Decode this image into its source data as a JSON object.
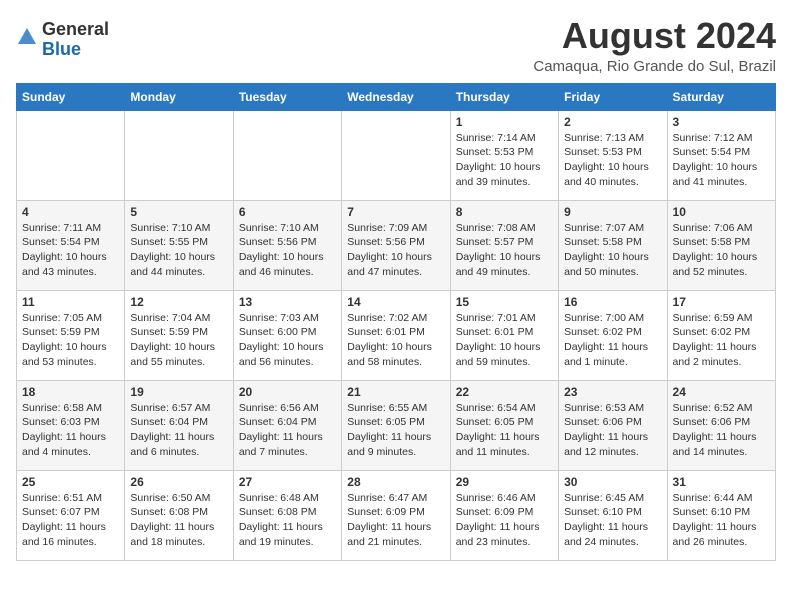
{
  "header": {
    "logo_general": "General",
    "logo_blue": "Blue",
    "month_title": "August 2024",
    "location": "Camaqua, Rio Grande do Sul, Brazil"
  },
  "days_of_week": [
    "Sunday",
    "Monday",
    "Tuesday",
    "Wednesday",
    "Thursday",
    "Friday",
    "Saturday"
  ],
  "weeks": [
    [
      {
        "day": "",
        "content": ""
      },
      {
        "day": "",
        "content": ""
      },
      {
        "day": "",
        "content": ""
      },
      {
        "day": "",
        "content": ""
      },
      {
        "day": "1",
        "content": "Sunrise: 7:14 AM\nSunset: 5:53 PM\nDaylight: 10 hours\nand 39 minutes."
      },
      {
        "day": "2",
        "content": "Sunrise: 7:13 AM\nSunset: 5:53 PM\nDaylight: 10 hours\nand 40 minutes."
      },
      {
        "day": "3",
        "content": "Sunrise: 7:12 AM\nSunset: 5:54 PM\nDaylight: 10 hours\nand 41 minutes."
      }
    ],
    [
      {
        "day": "4",
        "content": "Sunrise: 7:11 AM\nSunset: 5:54 PM\nDaylight: 10 hours\nand 43 minutes."
      },
      {
        "day": "5",
        "content": "Sunrise: 7:10 AM\nSunset: 5:55 PM\nDaylight: 10 hours\nand 44 minutes."
      },
      {
        "day": "6",
        "content": "Sunrise: 7:10 AM\nSunset: 5:56 PM\nDaylight: 10 hours\nand 46 minutes."
      },
      {
        "day": "7",
        "content": "Sunrise: 7:09 AM\nSunset: 5:56 PM\nDaylight: 10 hours\nand 47 minutes."
      },
      {
        "day": "8",
        "content": "Sunrise: 7:08 AM\nSunset: 5:57 PM\nDaylight: 10 hours\nand 49 minutes."
      },
      {
        "day": "9",
        "content": "Sunrise: 7:07 AM\nSunset: 5:58 PM\nDaylight: 10 hours\nand 50 minutes."
      },
      {
        "day": "10",
        "content": "Sunrise: 7:06 AM\nSunset: 5:58 PM\nDaylight: 10 hours\nand 52 minutes."
      }
    ],
    [
      {
        "day": "11",
        "content": "Sunrise: 7:05 AM\nSunset: 5:59 PM\nDaylight: 10 hours\nand 53 minutes."
      },
      {
        "day": "12",
        "content": "Sunrise: 7:04 AM\nSunset: 5:59 PM\nDaylight: 10 hours\nand 55 minutes."
      },
      {
        "day": "13",
        "content": "Sunrise: 7:03 AM\nSunset: 6:00 PM\nDaylight: 10 hours\nand 56 minutes."
      },
      {
        "day": "14",
        "content": "Sunrise: 7:02 AM\nSunset: 6:01 PM\nDaylight: 10 hours\nand 58 minutes."
      },
      {
        "day": "15",
        "content": "Sunrise: 7:01 AM\nSunset: 6:01 PM\nDaylight: 10 hours\nand 59 minutes."
      },
      {
        "day": "16",
        "content": "Sunrise: 7:00 AM\nSunset: 6:02 PM\nDaylight: 11 hours\nand 1 minute."
      },
      {
        "day": "17",
        "content": "Sunrise: 6:59 AM\nSunset: 6:02 PM\nDaylight: 11 hours\nand 2 minutes."
      }
    ],
    [
      {
        "day": "18",
        "content": "Sunrise: 6:58 AM\nSunset: 6:03 PM\nDaylight: 11 hours\nand 4 minutes."
      },
      {
        "day": "19",
        "content": "Sunrise: 6:57 AM\nSunset: 6:04 PM\nDaylight: 11 hours\nand 6 minutes."
      },
      {
        "day": "20",
        "content": "Sunrise: 6:56 AM\nSunset: 6:04 PM\nDaylight: 11 hours\nand 7 minutes."
      },
      {
        "day": "21",
        "content": "Sunrise: 6:55 AM\nSunset: 6:05 PM\nDaylight: 11 hours\nand 9 minutes."
      },
      {
        "day": "22",
        "content": "Sunrise: 6:54 AM\nSunset: 6:05 PM\nDaylight: 11 hours\nand 11 minutes."
      },
      {
        "day": "23",
        "content": "Sunrise: 6:53 AM\nSunset: 6:06 PM\nDaylight: 11 hours\nand 12 minutes."
      },
      {
        "day": "24",
        "content": "Sunrise: 6:52 AM\nSunset: 6:06 PM\nDaylight: 11 hours\nand 14 minutes."
      }
    ],
    [
      {
        "day": "25",
        "content": "Sunrise: 6:51 AM\nSunset: 6:07 PM\nDaylight: 11 hours\nand 16 minutes."
      },
      {
        "day": "26",
        "content": "Sunrise: 6:50 AM\nSunset: 6:08 PM\nDaylight: 11 hours\nand 18 minutes."
      },
      {
        "day": "27",
        "content": "Sunrise: 6:48 AM\nSunset: 6:08 PM\nDaylight: 11 hours\nand 19 minutes."
      },
      {
        "day": "28",
        "content": "Sunrise: 6:47 AM\nSunset: 6:09 PM\nDaylight: 11 hours\nand 21 minutes."
      },
      {
        "day": "29",
        "content": "Sunrise: 6:46 AM\nSunset: 6:09 PM\nDaylight: 11 hours\nand 23 minutes."
      },
      {
        "day": "30",
        "content": "Sunrise: 6:45 AM\nSunset: 6:10 PM\nDaylight: 11 hours\nand 24 minutes."
      },
      {
        "day": "31",
        "content": "Sunrise: 6:44 AM\nSunset: 6:10 PM\nDaylight: 11 hours\nand 26 minutes."
      }
    ]
  ]
}
